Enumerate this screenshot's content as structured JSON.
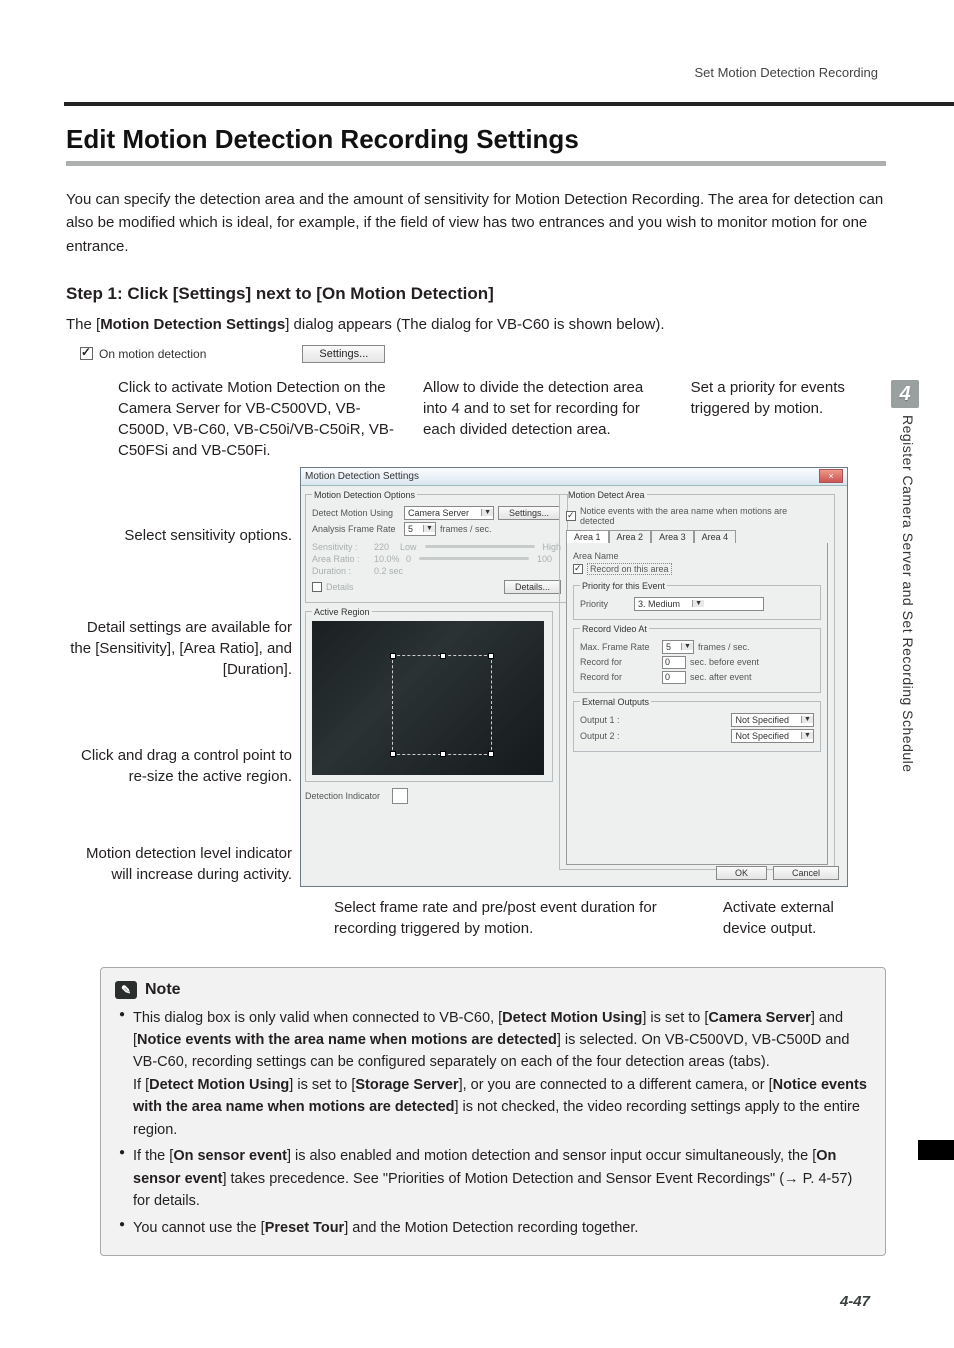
{
  "header": {
    "running": "Set Motion Detection Recording"
  },
  "chapter": {
    "num": "4",
    "side_title": "Register Camera Server and Set Recording Schedule"
  },
  "title": "Edit Motion Detection Recording Settings",
  "intro": "You can specify the detection area and the amount of sensitivity for Motion Detection Recording. The area for detection can also be modified which is ideal, for example, if the field of view has two entrances and you wish to monitor motion for one entrance.",
  "step1": {
    "heading": "Step 1: Click [Settings] next to [On Motion Detection]",
    "subtext_pre": "The [",
    "subtext_bold": "Motion Detection Settings",
    "subtext_post": "] dialog appears (The dialog for VB-C60 is shown below).",
    "checkbox_label": "On motion detection",
    "settings_btn": "Settings..."
  },
  "annot_row": {
    "c1": "Click to activate Motion Detection on the Camera Server for VB-C500VD, VB-C500D, VB-C60, VB-C50i/VB-C50iR, VB-C50FSi and VB-C50Fi.",
    "c2": "Allow to divide the detection area into 4 and to set for recording for each divided detection area.",
    "c3": "Set a priority for events triggered by motion."
  },
  "left": {
    "l1": "Select sensitivity options.",
    "l2": "Detail settings are available for the [Sensitivity], [Area Ratio], and [Duration].",
    "l3": "Click and drag a control point to re-size the active region.",
    "l4": "Motion detection level indicator will increase during activity."
  },
  "dialog": {
    "title": "Motion Detection Settings",
    "opt_legend": "Motion Detection Options",
    "detect_label": "Detect Motion Using",
    "detect_value": "Camera Server",
    "detect_settings": "Settings...",
    "afps_label": "Analysis Frame Rate",
    "afps_value": "5",
    "afps_unit": "frames / sec.",
    "sens_label": "Sensitivity :",
    "sens_val": "220",
    "low": "Low",
    "high": "High",
    "ar_label": "Area Ratio :",
    "ar_val": "10.0%",
    "zero": "0",
    "hundred": "100",
    "dur_label": "Duration :",
    "dur_val": "0.2 sec",
    "details_chk": "Details",
    "details_btn": "Details...",
    "active_region": "Active Region",
    "det_ind": "Detection Indicator",
    "area_legend": "Motion Detect Area",
    "notice_chk": "Notice events with the area name when motions are detected",
    "tabs": [
      "Area 1",
      "Area 2",
      "Area 3",
      "Area 4"
    ],
    "area_name_lbl": "Area Name",
    "record_area_chk": "Record on this area",
    "prio_legend": "Priority for this Event",
    "prio_lbl": "Priority",
    "prio_val": "3. Medium",
    "rva_legend": "Record Video At",
    "maxfr_lbl": "Max. Frame Rate",
    "maxfr_val": "5",
    "maxfr_unit": "frames / sec.",
    "rf_before_lbl": "Record for",
    "rf_before_val": "0",
    "rf_before_unit": "sec. before event",
    "rf_after_lbl": "Record for",
    "rf_after_val": "0",
    "rf_after_unit": "sec. after event",
    "ext_legend": "External Outputs",
    "out1": "Output 1 :",
    "out2": "Output 2 :",
    "notspec": "Not Specified",
    "ok": "OK",
    "cancel": "Cancel"
  },
  "bottom_annot": {
    "b1": "Select frame rate and pre/post event duration for recording triggered by motion.",
    "b2": "Activate external device output."
  },
  "note": {
    "title": "Note",
    "b1_a": "This dialog box is only valid when connected to VB-C60, [",
    "b1_b": "Detect Motion Using",
    "b1_c": "] is set to [",
    "b1_d": "Camera Server",
    "b1_e": "] and [",
    "b1_f": "Notice events with the area name when motions are detected",
    "b1_g": "] is selected. On VB-C500VD, VB-C500D and VB-C60, recording settings can be configured separately on each of the four detection areas (tabs).",
    "b1_h": "If [",
    "b1_i": "Detect Motion Using",
    "b1_j": "] is set to [",
    "b1_k": "Storage Server",
    "b1_l": "], or you are connected to a different camera, or [",
    "b1_m": "Notice events with the area name when motions are detected",
    "b1_n": "] is not checked, the video recording settings apply to the entire region.",
    "b2_a": "If the [",
    "b2_b": "On sensor event",
    "b2_c": "] is also enabled and motion detection and sensor input occur simultaneously, the [",
    "b2_d": "On sensor event",
    "b2_e": "] takes precedence. See \"Priorities of Motion Detection and Sensor Event Recordings\" (→ P. 4-57) for details.",
    "b3_a": "You cannot use the [",
    "b3_b": "Preset Tour",
    "b3_c": "] and the Motion Detection recording together."
  },
  "pagenum": "4-47"
}
